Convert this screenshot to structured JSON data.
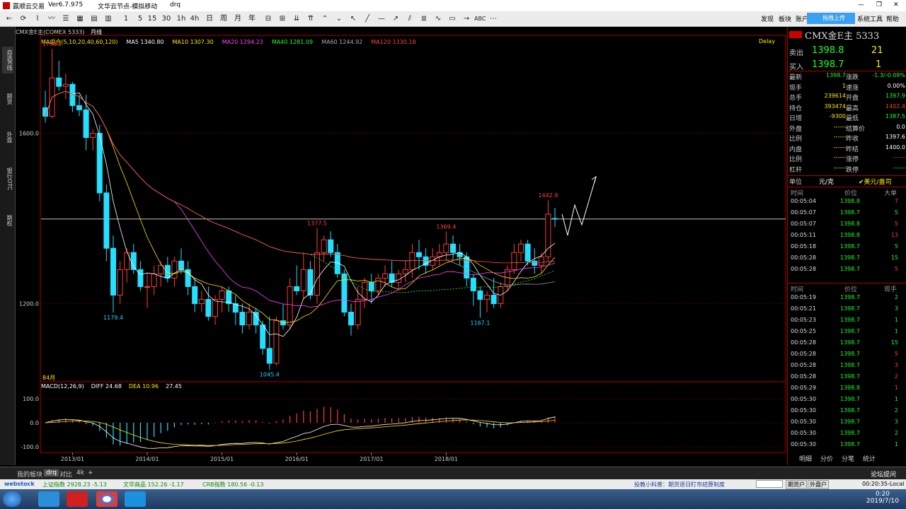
{
  "titlebar": {
    "app": "赢顺云交易",
    "version": "Ver6.7.975",
    "node": "文华云节点-模拟移动",
    "user": "drq"
  },
  "toolbar": {
    "periods": [
      "1",
      "5",
      "15",
      "30",
      "1h",
      "4h",
      "日",
      "周",
      "月",
      "年"
    ],
    "right": [
      "发现",
      "板块",
      "账户",
      "系统工具",
      "帮助"
    ],
    "upload_label": "拖拽上传"
  },
  "leftbar": [
    "自选K线",
    "期货",
    "外盘",
    "银行OTC",
    "期权"
  ],
  "chart": {
    "symbol_header": "CMX金E主(COMEX 5333)",
    "period": "月线",
    "delay": "Delay",
    "ma_legend": [
      {
        "text": "MA组合(5,10,20,40,60,120)",
        "color": "#ffe600"
      },
      {
        "text": "MA5 1340.80",
        "color": "#ffffff"
      },
      {
        "text": "MA10 1307.30",
        "color": "#ffe600"
      },
      {
        "text": "MA20 1294.23",
        "color": "#ff44ff"
      },
      {
        "text": "MA40 1281.09",
        "color": "#22ff22"
      },
      {
        "text": "MA60 1244.92",
        "color": "#aaaaaa"
      },
      {
        "text": "MA120 1330.18",
        "color": "#ff4444"
      }
    ],
    "macd_legend": [
      {
        "text": "MACD(12,26,9)",
        "color": "#ffffff"
      },
      {
        "text": "DIFF 24.68",
        "color": "#ffffff"
      },
      {
        "text": "DEA 10.96",
        "color": "#ffe600"
      },
      {
        "text": "27.45",
        "color": "#ffffff"
      }
    ],
    "count_label": "84月",
    "price_labels": [
      {
        "text": "1798.1",
        "color": "#ff4444"
      },
      {
        "text": "1179.4",
        "color": "#22d3ff"
      },
      {
        "text": "1045.4",
        "color": "#22d3ff"
      },
      {
        "text": "1377.5",
        "color": "#ff4444"
      },
      {
        "text": "1369.4",
        "color": "#ff4444"
      },
      {
        "text": "1167.1",
        "color": "#22d3ff"
      },
      {
        "text": "1442.9",
        "color": "#ff4444"
      }
    ],
    "y_ticks": [
      "1600.0",
      "1200.0"
    ],
    "macd_ticks": [
      "100.0",
      "0.0",
      "-100.0"
    ],
    "x_ticks": [
      "2013/01",
      "2014/01",
      "2015/01",
      "2016/01",
      "2017/01",
      "2018/01"
    ],
    "chart_data": {
      "type": "candlestick",
      "title": "CMX金E主(COMEX 5333)",
      "period": "月线",
      "ylim": [
        1020,
        1800
      ],
      "candles": [
        {
          "o": 1660,
          "h": 1700,
          "l": 1625,
          "c": 1640,
          "up": false
        },
        {
          "o": 1640,
          "h": 1798.1,
          "l": 1635,
          "c": 1730,
          "up": true
        },
        {
          "o": 1730,
          "h": 1770,
          "l": 1700,
          "c": 1710,
          "up": false
        },
        {
          "o": 1710,
          "h": 1740,
          "l": 1680,
          "c": 1715,
          "up": true
        },
        {
          "o": 1715,
          "h": 1720,
          "l": 1650,
          "c": 1665,
          "up": false
        },
        {
          "o": 1665,
          "h": 1690,
          "l": 1640,
          "c": 1655,
          "up": false
        },
        {
          "o": 1655,
          "h": 1690,
          "l": 1560,
          "c": 1590,
          "up": false
        },
        {
          "o": 1590,
          "h": 1610,
          "l": 1560,
          "c": 1600,
          "up": true
        },
        {
          "o": 1600,
          "h": 1620,
          "l": 1440,
          "c": 1460,
          "up": false
        },
        {
          "o": 1460,
          "h": 1480,
          "l": 1300,
          "c": 1330,
          "up": false
        },
        {
          "o": 1330,
          "h": 1360,
          "l": 1179.4,
          "c": 1220,
          "up": false
        },
        {
          "o": 1220,
          "h": 1300,
          "l": 1200,
          "c": 1280,
          "up": true
        },
        {
          "o": 1280,
          "h": 1330,
          "l": 1250,
          "c": 1320,
          "up": true
        },
        {
          "o": 1320,
          "h": 1340,
          "l": 1270,
          "c": 1280,
          "up": false
        },
        {
          "o": 1280,
          "h": 1300,
          "l": 1230,
          "c": 1240,
          "up": false
        },
        {
          "o": 1240,
          "h": 1270,
          "l": 1190,
          "c": 1240,
          "up": true
        },
        {
          "o": 1240,
          "h": 1290,
          "l": 1220,
          "c": 1270,
          "up": true
        },
        {
          "o": 1270,
          "h": 1300,
          "l": 1240,
          "c": 1290,
          "up": true
        },
        {
          "o": 1290,
          "h": 1310,
          "l": 1250,
          "c": 1260,
          "up": false
        },
        {
          "o": 1260,
          "h": 1310,
          "l": 1240,
          "c": 1300,
          "up": true
        },
        {
          "o": 1300,
          "h": 1330,
          "l": 1270,
          "c": 1280,
          "up": false
        },
        {
          "o": 1280,
          "h": 1300,
          "l": 1220,
          "c": 1240,
          "up": false
        },
        {
          "o": 1240,
          "h": 1260,
          "l": 1180,
          "c": 1200,
          "up": false
        },
        {
          "o": 1200,
          "h": 1230,
          "l": 1180,
          "c": 1210,
          "up": true
        },
        {
          "o": 1210,
          "h": 1240,
          "l": 1160,
          "c": 1170,
          "up": false
        },
        {
          "o": 1170,
          "h": 1220,
          "l": 1150,
          "c": 1210,
          "up": true
        },
        {
          "o": 1210,
          "h": 1240,
          "l": 1180,
          "c": 1230,
          "up": true
        },
        {
          "o": 1230,
          "h": 1240,
          "l": 1180,
          "c": 1200,
          "up": false
        },
        {
          "o": 1200,
          "h": 1220,
          "l": 1150,
          "c": 1180,
          "up": false
        },
        {
          "o": 1180,
          "h": 1200,
          "l": 1130,
          "c": 1150,
          "up": false
        },
        {
          "o": 1150,
          "h": 1200,
          "l": 1140,
          "c": 1180,
          "up": true
        },
        {
          "o": 1180,
          "h": 1190,
          "l": 1130,
          "c": 1150,
          "up": false
        },
        {
          "o": 1150,
          "h": 1160,
          "l": 1080,
          "c": 1095,
          "up": false
        },
        {
          "o": 1095,
          "h": 1170,
          "l": 1045.4,
          "c": 1060,
          "up": false
        },
        {
          "o": 1060,
          "h": 1170,
          "l": 1055,
          "c": 1160,
          "up": true
        },
        {
          "o": 1160,
          "h": 1200,
          "l": 1140,
          "c": 1150,
          "up": false
        },
        {
          "o": 1150,
          "h": 1260,
          "l": 1140,
          "c": 1240,
          "up": true
        },
        {
          "o": 1240,
          "h": 1290,
          "l": 1220,
          "c": 1230,
          "up": false
        },
        {
          "o": 1230,
          "h": 1320,
          "l": 1210,
          "c": 1280,
          "up": true
        },
        {
          "o": 1280,
          "h": 1300,
          "l": 1210,
          "c": 1220,
          "up": false
        },
        {
          "o": 1220,
          "h": 1377.5,
          "l": 1200,
          "c": 1320,
          "up": true
        },
        {
          "o": 1320,
          "h": 1360,
          "l": 1300,
          "c": 1350,
          "up": true
        },
        {
          "o": 1350,
          "h": 1370,
          "l": 1310,
          "c": 1320,
          "up": false
        },
        {
          "o": 1320,
          "h": 1340,
          "l": 1260,
          "c": 1270,
          "up": false
        },
        {
          "o": 1270,
          "h": 1280,
          "l": 1170,
          "c": 1180,
          "up": false
        },
        {
          "o": 1180,
          "h": 1200,
          "l": 1125,
          "c": 1150,
          "up": false
        },
        {
          "o": 1150,
          "h": 1240,
          "l": 1140,
          "c": 1210,
          "up": true
        },
        {
          "o": 1210,
          "h": 1260,
          "l": 1190,
          "c": 1250,
          "up": true
        },
        {
          "o": 1250,
          "h": 1270,
          "l": 1200,
          "c": 1230,
          "up": false
        },
        {
          "o": 1230,
          "h": 1270,
          "l": 1220,
          "c": 1260,
          "up": true
        },
        {
          "o": 1260,
          "h": 1290,
          "l": 1240,
          "c": 1270,
          "up": true
        },
        {
          "o": 1270,
          "h": 1300,
          "l": 1240,
          "c": 1250,
          "up": false
        },
        {
          "o": 1250,
          "h": 1280,
          "l": 1230,
          "c": 1270,
          "up": true
        },
        {
          "o": 1270,
          "h": 1300,
          "l": 1250,
          "c": 1280,
          "up": true
        },
        {
          "o": 1280,
          "h": 1340,
          "l": 1260,
          "c": 1320,
          "up": true
        },
        {
          "o": 1320,
          "h": 1350,
          "l": 1280,
          "c": 1310,
          "up": false
        },
        {
          "o": 1310,
          "h": 1330,
          "l": 1270,
          "c": 1290,
          "up": false
        },
        {
          "o": 1290,
          "h": 1330,
          "l": 1280,
          "c": 1310,
          "up": true
        },
        {
          "o": 1310,
          "h": 1340,
          "l": 1290,
          "c": 1320,
          "up": true
        },
        {
          "o": 1320,
          "h": 1369.4,
          "l": 1300,
          "c": 1340,
          "up": true
        },
        {
          "o": 1340,
          "h": 1360,
          "l": 1300,
          "c": 1320,
          "up": false
        },
        {
          "o": 1320,
          "h": 1340,
          "l": 1290,
          "c": 1310,
          "up": false
        },
        {
          "o": 1310,
          "h": 1320,
          "l": 1240,
          "c": 1260,
          "up": false
        },
        {
          "o": 1260,
          "h": 1270,
          "l": 1195,
          "c": 1230,
          "up": false
        },
        {
          "o": 1230,
          "h": 1240,
          "l": 1167.1,
          "c": 1210,
          "up": false
        },
        {
          "o": 1210,
          "h": 1230,
          "l": 1180,
          "c": 1220,
          "up": true
        },
        {
          "o": 1220,
          "h": 1260,
          "l": 1190,
          "c": 1200,
          "up": false
        },
        {
          "o": 1200,
          "h": 1250,
          "l": 1190,
          "c": 1240,
          "up": true
        },
        {
          "o": 1240,
          "h": 1290,
          "l": 1230,
          "c": 1280,
          "up": true
        },
        {
          "o": 1280,
          "h": 1340,
          "l": 1270,
          "c": 1320,
          "up": true
        },
        {
          "o": 1320,
          "h": 1350,
          "l": 1300,
          "c": 1340,
          "up": true
        },
        {
          "o": 1340,
          "h": 1350,
          "l": 1290,
          "c": 1300,
          "up": false
        },
        {
          "o": 1300,
          "h": 1330,
          "l": 1270,
          "c": 1290,
          "up": false
        },
        {
          "o": 1290,
          "h": 1320,
          "l": 1270,
          "c": 1310,
          "up": true
        },
        {
          "o": 1310,
          "h": 1442.9,
          "l": 1300,
          "c": 1410,
          "up": true
        },
        {
          "o": 1400,
          "h": 1425,
          "l": 1380,
          "c": 1398.7,
          "up": false
        }
      ],
      "macd": {
        "diff": 24.68,
        "dea": 10.96,
        "macd": 27.45
      }
    }
  },
  "quote": {
    "title": "CMX金E主 5333",
    "sell_label": "卖出",
    "sell_price": "1398.8",
    "sell_vol": "21",
    "buy_label": "买入",
    "buy_price": "1398.7",
    "buy_vol": "1",
    "rows": [
      {
        "l1": "最新",
        "v1": "1398.7",
        "c1": "#1bff2b",
        "l2": "涨跌",
        "v2": "-1.3/-0.09%",
        "c2": "#1bff2b"
      },
      {
        "l1": "现手",
        "v1": "1",
        "c1": "#ffe600",
        "l2": "速涨",
        "v2": "0.00%",
        "c2": "#ffffff"
      },
      {
        "l1": "总手",
        "v1": "239614",
        "c1": "#ffe600",
        "l2": "开盘",
        "v2": "1397.9",
        "c2": "#1bff2b"
      },
      {
        "l1": "持仓",
        "v1": "393474",
        "c1": "#ffe600",
        "l2": "最高",
        "v2": "1402.4",
        "c2": "#ff3b3b"
      },
      {
        "l1": "日增",
        "v1": "-9300",
        "c1": "#ffe600",
        "l2": "最低",
        "v2": "1387.5",
        "c2": "#1bff2b"
      },
      {
        "l1": "外盘",
        "v1": "------",
        "c1": "#ffe600",
        "l2": "结算价",
        "v2": "0.0",
        "c2": "#ffffff"
      },
      {
        "l1": "比例",
        "v1": "------",
        "c1": "#ffe600",
        "l2": "昨收",
        "v2": "1397.6",
        "c2": "#ffffff"
      },
      {
        "l1": "内盘",
        "v1": "------",
        "c1": "#ffe600",
        "l2": "昨结",
        "v2": "1400.0",
        "c2": "#ffffff"
      },
      {
        "l1": "比例",
        "v1": "------",
        "c1": "#ffe600",
        "l2": "涨停",
        "v2": "------",
        "c2": "#ff3b3b"
      },
      {
        "l1": "杠杆",
        "v1": "------",
        "c1": "#ffe600",
        "l2": "跌停",
        "v2": "------",
        "c2": "#1bff2b"
      }
    ],
    "unit_label": "单位",
    "unit_value": "元/克",
    "unit_alt": "美元/盎司",
    "big_header": {
      "time": "时间",
      "price": "价位",
      "vol": "大单"
    },
    "big_orders": [
      {
        "t": "00:05:04",
        "p": "1398.8",
        "v": "7",
        "c": "#ff3b3b"
      },
      {
        "t": "00:05:07",
        "p": "1398.7",
        "v": "5",
        "c": "#1bff2b"
      },
      {
        "t": "00:05:07",
        "p": "1398.8",
        "v": "5",
        "c": "#ff3b3b"
      },
      {
        "t": "00:05:11",
        "p": "1398.8",
        "v": "13",
        "c": "#ff3b3b"
      },
      {
        "t": "00:05:18",
        "p": "1398.7",
        "v": "5",
        "c": "#1bff2b"
      },
      {
        "t": "00:05:28",
        "p": "1398.7",
        "v": "15",
        "c": "#1bff2b"
      },
      {
        "t": "00:05:28",
        "p": "1398.7",
        "v": "5",
        "c": "#ff3b3b"
      }
    ],
    "tick_header": {
      "time": "时间",
      "price": "价位",
      "vol": "现手"
    },
    "ticks": [
      {
        "t": "00:05:19",
        "p": "1398.7",
        "v": "2",
        "c": "#1bff2b"
      },
      {
        "t": "00:05:21",
        "p": "1398.7",
        "v": "3",
        "c": "#1bff2b"
      },
      {
        "t": "00:05:23",
        "p": "1398.7",
        "v": "1",
        "c": "#1bff2b"
      },
      {
        "t": "00:05:25",
        "p": "1398.7",
        "v": "1",
        "c": "#1bff2b"
      },
      {
        "t": "00:05:28",
        "p": "1398.7",
        "v": "15",
        "c": "#1bff2b"
      },
      {
        "t": "00:05:28",
        "p": "1398.7",
        "v": "5",
        "c": "#ff3b3b"
      },
      {
        "t": "00:05:28",
        "p": "1398.7",
        "v": "3",
        "c": "#ff3b3b"
      },
      {
        "t": "00:05:28",
        "p": "1398.7",
        "v": "2",
        "c": "#ff3b3b"
      },
      {
        "t": "00:05:29",
        "p": "1398.8",
        "v": "1",
        "c": "#ff3b3b"
      },
      {
        "t": "00:05:30",
        "p": "1398.7",
        "v": "1",
        "c": "#1bff2b"
      },
      {
        "t": "00:05:30",
        "p": "1398.7",
        "v": "2",
        "c": "#1bff2b"
      },
      {
        "t": "00:05:30",
        "p": "1398.7",
        "v": "3",
        "c": "#1bff2b"
      },
      {
        "t": "00:05:30",
        "p": "1398.7",
        "v": "2",
        "c": "#1bff2b"
      },
      {
        "t": "00:05:30",
        "p": "1398.7",
        "v": "1",
        "c": "#1bff2b"
      }
    ],
    "footer_tabs": [
      "明细",
      "分价",
      "分笔",
      "统计"
    ]
  },
  "bottom_tabs": [
    "我的板块",
    "drq",
    "对比",
    "4k"
  ],
  "forum_label": "论坛提问",
  "statusbar": {
    "brand": "webstock",
    "idx1": "上证指数 2928.23 -5.13",
    "idx2": "文华商品 152.26 -1.17",
    "idx3": "CRB指数 180.56 -0.13",
    "notice": "投教小科普：期货逐日盯市结算制度",
    "btn1": "期货户",
    "btn2": "外盘户",
    "time": "00:20:35-Local"
  },
  "taskbar": {
    "time": "0:20",
    "date": "2019/7/10"
  }
}
